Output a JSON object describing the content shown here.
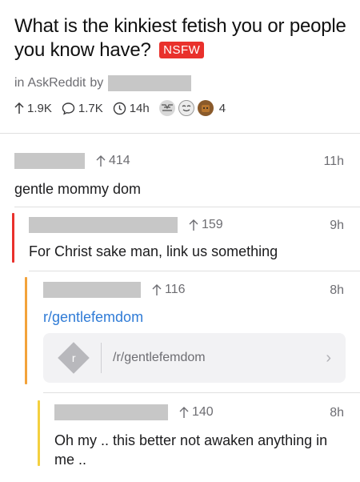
{
  "post": {
    "title": "What is the kinkiest fetish you or people you know have?",
    "nsfw": "NSFW",
    "in_label": "in",
    "subreddit": "AskReddit",
    "by_label": "by",
    "upvotes": "1.9K",
    "comments": "1.7K",
    "age": "14h",
    "award_count": "4"
  },
  "comments": [
    {
      "score": "414",
      "time": "11h",
      "body": "gentle mommy dom"
    },
    {
      "score": "159",
      "time": "9h",
      "body": "For Christ sake man, link us something"
    },
    {
      "score": "116",
      "time": "8h",
      "body": "r/gentlefemdom"
    },
    {
      "score": "140",
      "time": "8h",
      "body": "Oh my .. this better not awaken anything in me .."
    }
  ],
  "link_card": {
    "icon_letter": "r",
    "url": "/r/gentlefemdom",
    "chevron": "›"
  },
  "colors": {
    "nsfw": "#e9312c",
    "depth1": "#e9312c",
    "depth2": "#f2a23a",
    "depth3": "#f4d03f",
    "link": "#2f7bd6"
  },
  "icons": [
    "upvote-arrow-icon",
    "comment-bubble-icon",
    "clock-icon",
    "award-icon",
    "chevron-right-icon",
    "reddit-link-icon"
  ]
}
